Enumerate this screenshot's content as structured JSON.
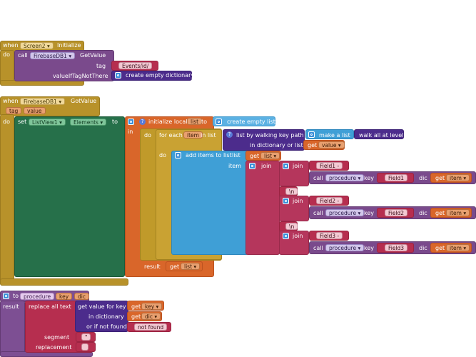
{
  "block1": {
    "when": "when",
    "component": "Screen2",
    "event": "Initialize",
    "do": "do",
    "call": "call",
    "db": "FirebaseDB1",
    "method": "GetValue",
    "tag_label": "tag",
    "tag_value": "Events/id/",
    "value_if_label": "valueIfTagNotThere",
    "empty_dict": "create empty dictionary"
  },
  "block2": {
    "when": "when",
    "db": "FirebaseDB1",
    "event": "GotValue",
    "param_tag": "tag",
    "param_value": "value",
    "do": "do",
    "set": "set",
    "listview": "ListView1",
    "elements": "Elements",
    "to": "to",
    "init_local": "initialize local",
    "local_name": "list",
    "to2": "to",
    "create_empty_list": "create empty list",
    "in": "in",
    "do2": "do",
    "for_each": "for each",
    "item_var": "item",
    "in_list": "in list",
    "walk_path": "list by walking key path",
    "make_list": "make a list",
    "walk_all": "walk all at level",
    "in_dict": "in dictionary or list",
    "get": "get",
    "get_value": "value",
    "do3": "do",
    "add_items": "add items to list",
    "list_label": "list",
    "get_list": "list",
    "item_label": "item",
    "join": "join",
    "field1": "Field1",
    "field2": "Field2",
    "field3": "Field3",
    "call": "call",
    "procedure": "procedure",
    "key": "key",
    "dic": "dic",
    "get_item": "item",
    "newline": "\\n",
    "result": "result"
  },
  "block3": {
    "to": "to",
    "procedure": "procedure",
    "p_key": "key",
    "p_dic": "dic",
    "result": "result",
    "replace_all": "replace all text",
    "get_value_for_key": "get value for key",
    "get": "get",
    "key": "key",
    "in_dictionary": "in dictionary",
    "dic": "dic",
    "or_if_not_found": "or if not found",
    "not_found": "not found",
    "segment": "segment",
    "segment_value": "\"",
    "replacement": "replacement",
    "replacement_value": ""
  }
}
